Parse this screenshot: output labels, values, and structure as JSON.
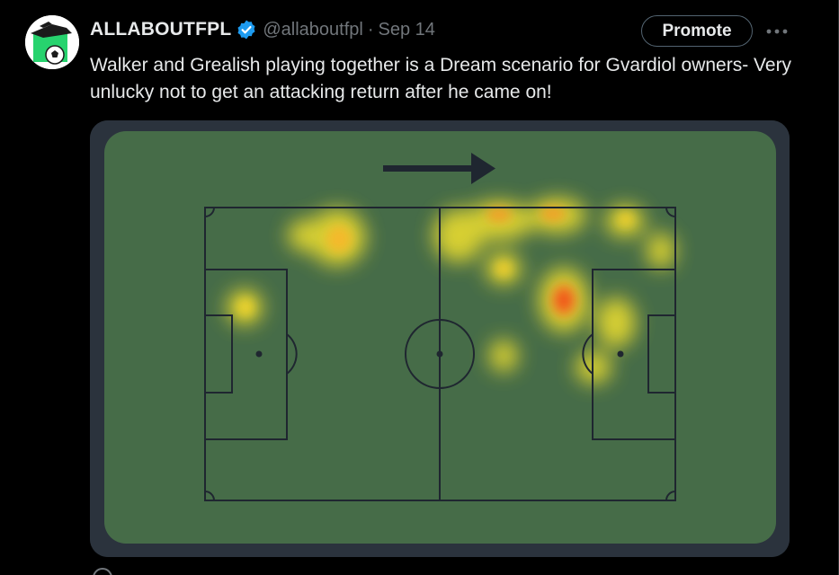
{
  "tweet": {
    "display_name": "ALLABOUTFPL",
    "verified_icon": "verified-badge-icon",
    "handle": "@allaboutfpl",
    "separator": "·",
    "date": "Sep 14",
    "promote_label": "Promote",
    "more_icon": "more-horizontal-icon",
    "text": "Walker and Grealish playing together is a Dream scenario for Gvardiol owners- Very unlucky not to get an attacking return after he came on!",
    "avatar_icon": "football-boot-and-ball-logo"
  },
  "media": {
    "type": "heatmap",
    "direction_arrow_icon": "arrow-right-icon",
    "colors": {
      "pitch": "#466c48",
      "frame": "#2b333d",
      "lines": "#1f2630",
      "heat_low": "#f1e12d",
      "heat_high": "#f04a1c"
    }
  },
  "colors": {
    "background": "#000000",
    "text": "#e7e9ea",
    "muted": "#71767b",
    "verified": "#1d9bf0"
  }
}
